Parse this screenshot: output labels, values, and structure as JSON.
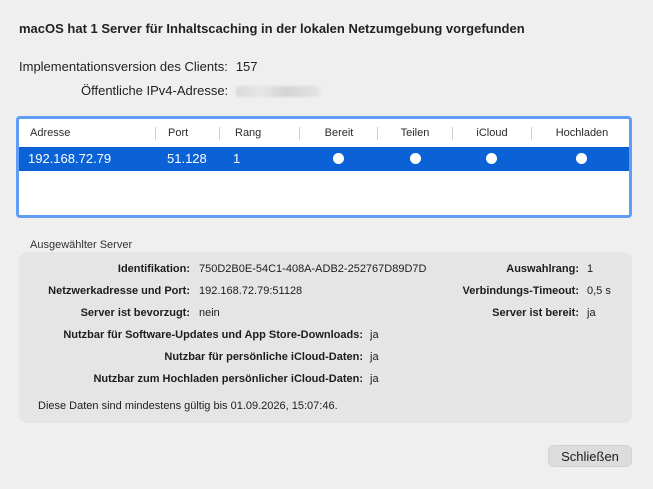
{
  "dialog": {
    "title": "macOS hat 1 Server für Inhaltscaching in der lokalen Netzumgebung vorgefunden",
    "impl_label": "Implementationsversion des Clients:",
    "impl_value": "157",
    "ipv4_label": "Öffentliche IPv4-Adresse:"
  },
  "table": {
    "headers": {
      "address": "Adresse",
      "port": "Port",
      "rank": "Rang",
      "ready": "Bereit",
      "share": "Teilen",
      "icloud": "iCloud",
      "upload": "Hochladen"
    },
    "rows": [
      {
        "address": "192.168.72.79",
        "port": "51.128",
        "rank": "1"
      }
    ],
    "colors": {
      "selection": "#0b62d6",
      "focus_ring": "#5e9ef6"
    }
  },
  "selected": {
    "section_label": "Ausgewählter Server",
    "id_label": "Identifikation:",
    "id_value": "750D2B0E-54C1-408A-ADB2-252767D89D7D",
    "netaddr_label": "Netzwerkadresse und Port:",
    "netaddr_value": "192.168.72.79:51128",
    "preferred_label": "Server ist bevorzugt:",
    "preferred_value": "nein",
    "rank_label": "Auswahlrang:",
    "rank_value": "1",
    "timeout_label": "Verbindungs-Timeout:",
    "timeout_value": "0,5 s",
    "ready_label": "Server ist bereit:",
    "ready_value": "ja",
    "sw_label": "Nutzbar für Software-Updates und App Store-Downloads:",
    "sw_value": "ja",
    "icloud_label": "Nutzbar für persönliche iCloud-Daten:",
    "icloud_value": "ja",
    "upload_label": "Nutzbar zum Hochladen persönlicher iCloud-Daten:",
    "upload_value": "ja",
    "validity": "Diese Daten sind mindestens gültig bis 01.09.2026, 15:07:46."
  },
  "buttons": {
    "close": "Schließen"
  }
}
